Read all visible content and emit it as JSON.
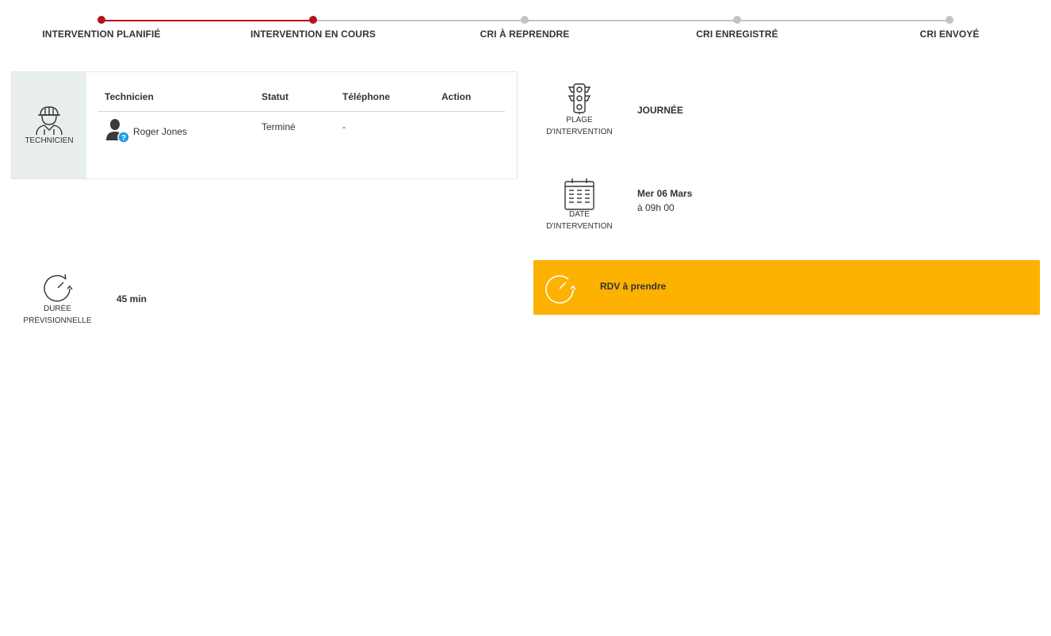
{
  "stepper": {
    "steps": [
      {
        "label": "INTERVENTION PLANIFIÉ",
        "status": "done"
      },
      {
        "label": "INTERVENTION EN COURS",
        "status": "done"
      },
      {
        "label": "CRI À REPRENDRE",
        "status": "todo"
      },
      {
        "label": "CRI ENREGISTRÉ",
        "status": "todo"
      },
      {
        "label": "CRI ENVOYÉ",
        "status": "todo"
      }
    ],
    "colors": {
      "done": "#b5121b",
      "todo": "#c4c4c4"
    }
  },
  "technicien": {
    "icon": "worker-helmet-icon",
    "label": "TECHNICIEN",
    "table": {
      "headers": {
        "technicien": "Technicien",
        "statut": "Statut",
        "telephone": "Téléphone",
        "action": "Action"
      },
      "rows": [
        {
          "name": "Roger Jones",
          "statut": "Terminé",
          "telephone": "-",
          "action": ""
        }
      ]
    }
  },
  "plage": {
    "icon": "traffic-light-icon",
    "label_line1": "PLAGE",
    "label_line2": "D'INTERVENTION",
    "value": "JOURNÉE"
  },
  "date": {
    "icon": "calendar-icon",
    "label_line1": "DATE",
    "label_line2": "D'INTERVENTION",
    "day": "Mer 06 Mars",
    "time": "à 09h 00"
  },
  "duree": {
    "icon": "timer-icon",
    "label_line1": "DURÉE",
    "label_line2": "PRÉVISIONNELLE",
    "value": "45 min"
  },
  "rdv": {
    "icon": "timer-icon",
    "label": "RDV à prendre",
    "color": "#fdb100"
  }
}
